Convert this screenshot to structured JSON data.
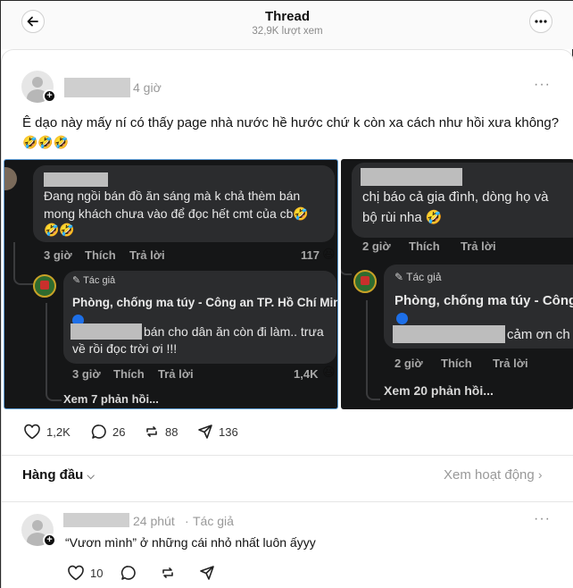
{
  "header": {
    "title": "Thread",
    "views": "32,9K lượt xem"
  },
  "post": {
    "time": "4 giờ",
    "text": "Ê dạo này mấy ní có thấy page nhà nước hề hước chứ k còn xa cách như hồi xưa không?",
    "emojis": "🤣🤣🤣",
    "likes": "1,2K",
    "comments": "26",
    "reposts": "88",
    "shares": "136"
  },
  "screenshot1": {
    "comment_line1": "Đang ngồi bán đồ ăn sáng mà k chả thèm bán",
    "comment_line2": "mong khách chưa vào để đọc hết cmt của cb🤣",
    "comment_emoji": "🤣🤣",
    "meta_time": "3 giờ",
    "meta_like": "Thích",
    "meta_reply": "Trả lời",
    "meta_count": "117",
    "author_tag": "Tác giả",
    "page_name": "Phòng, chống ma túy - Công an TP. Hồ Chí Minh",
    "reply_line1": "bán cho dân ăn còn đi làm.. trưa",
    "reply_line2": "về rồi đọc trời ơi !!!",
    "reply_time": "3 giờ",
    "reply_like": "Thích",
    "reply_reply": "Trả lời",
    "reply_count": "1,4K",
    "more_replies": "Xem 7 phản hồi..."
  },
  "screenshot2": {
    "comment_line1": "chị báo cả gia đình, dòng họ và",
    "comment_line2": "bộ rùi nha 🤣",
    "meta_time": "2 giờ",
    "meta_like": "Thích",
    "meta_reply": "Trả lời",
    "author_tag": "Tác giả",
    "page_name": "Phòng, chống ma túy - Công",
    "reply_line1": "cảm ơn ch",
    "reply_time": "2 giờ",
    "reply_like": "Thích",
    "reply_reply": "Trả lời",
    "more_replies": "Xem 20 phản hồi..."
  },
  "sort": {
    "label": "Hàng đầu",
    "activity": "Xem hoạt động"
  },
  "reply": {
    "time": "24 phút",
    "author_tag": "Tác giả",
    "text": "“Vươn mình” ở những cái nhỏ nhất luôn ấyyy",
    "likes": "10"
  }
}
